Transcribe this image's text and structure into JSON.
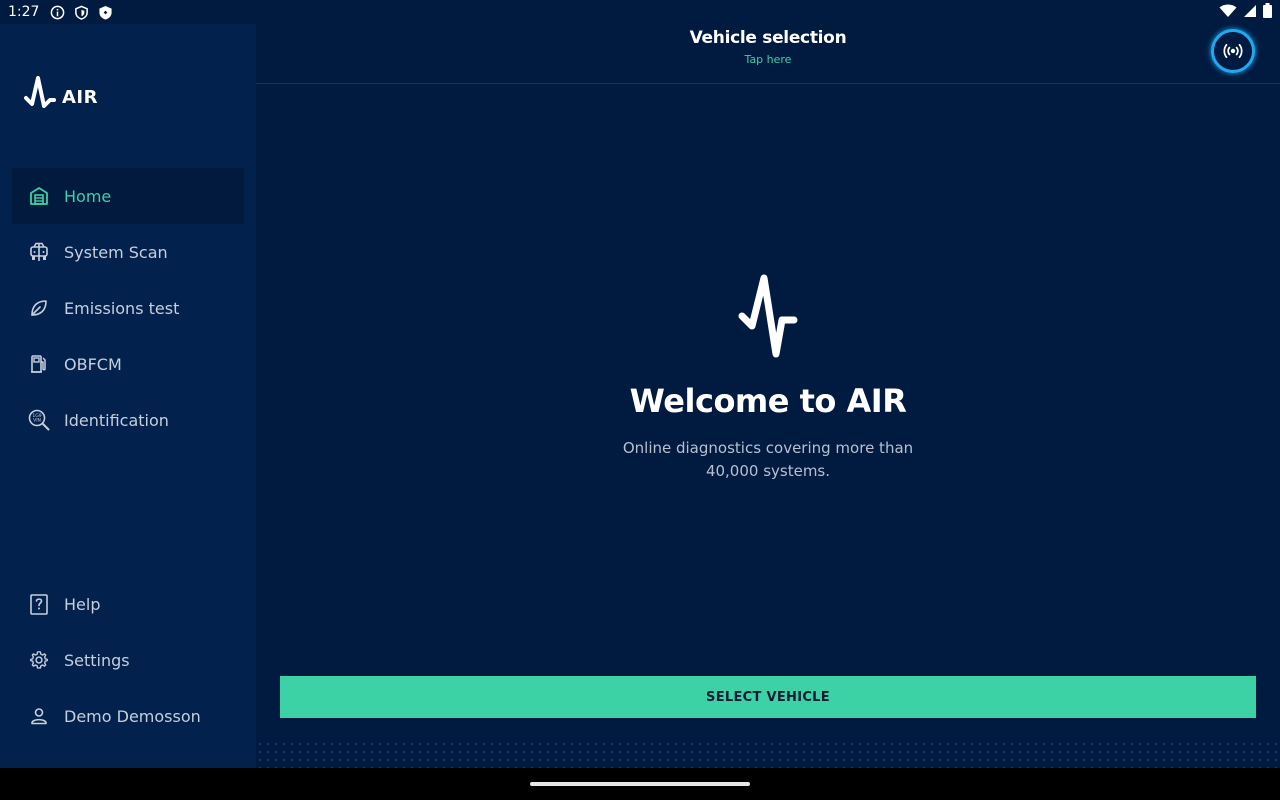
{
  "status_bar": {
    "time": "1:27",
    "left_icons": [
      "info-icon",
      "shield-outline-icon",
      "shield-filled-icon"
    ],
    "right_icons": [
      "wifi-icon",
      "signal-icon",
      "battery-icon"
    ]
  },
  "app": {
    "name": "AIR"
  },
  "sidebar": {
    "items": [
      {
        "label": "Home",
        "icon": "garage-icon",
        "active": true
      },
      {
        "label": "System Scan",
        "icon": "car-scan-icon",
        "active": false
      },
      {
        "label": "Emissions test",
        "icon": "leaf-icon",
        "active": false
      },
      {
        "label": "OBFCM",
        "icon": "fuel-pump-icon",
        "active": false
      },
      {
        "label": "Identification",
        "icon": "vin-search-icon",
        "active": false
      }
    ],
    "bottom_items": [
      {
        "label": "Help",
        "icon": "help-icon"
      },
      {
        "label": "Settings",
        "icon": "gear-icon"
      },
      {
        "label": "Demo Demosson",
        "icon": "user-icon"
      }
    ]
  },
  "header": {
    "title": "Vehicle selection",
    "subtitle": "Tap here",
    "connection_icon": "broadcast-icon"
  },
  "main": {
    "welcome_title": "Welcome to AIR",
    "description": "Online diagnostics covering more than 40,000 systems.",
    "select_button": "SELECT VEHICLE"
  },
  "colors": {
    "background": "#001a40",
    "sidebar": "#03214d",
    "accent": "#3dd1a6",
    "connection_ring": "#1fa9f0"
  }
}
